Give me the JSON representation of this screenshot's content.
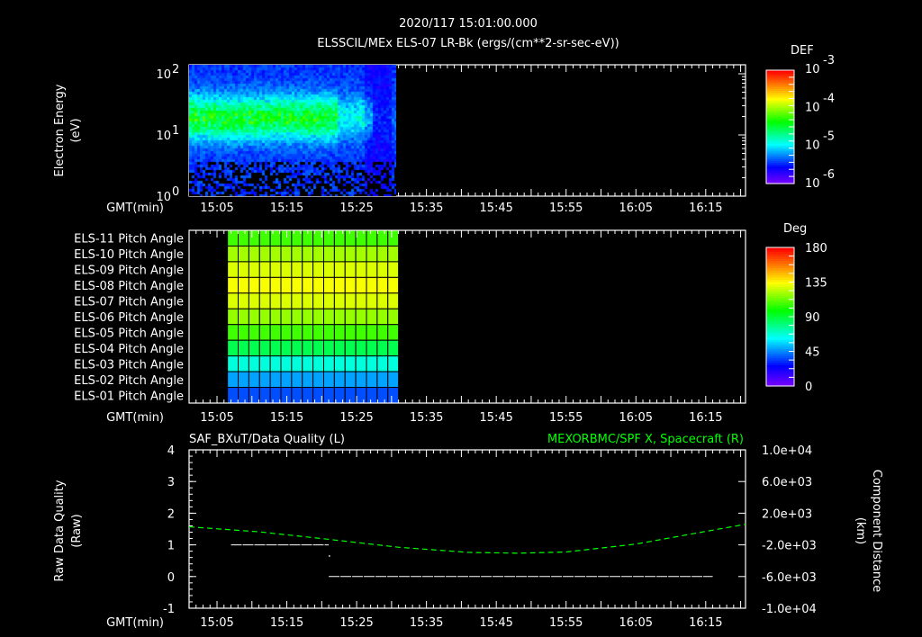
{
  "header": {
    "timestamp": "2020/117 15:01:00.000",
    "title": "ELSSCIL/MEx ELS-07 LR-Bk  (ergs/(cm**2-sr-sec-eV))"
  },
  "time_axis": {
    "label": "GMT(min)",
    "start_min": 901,
    "end_min": 980.7,
    "ticks": [
      "15:05",
      "15:15",
      "15:25",
      "15:35",
      "15:45",
      "15:55",
      "16:05",
      "16:15"
    ],
    "tick_minutes": [
      905,
      915,
      925,
      935,
      945,
      955,
      965,
      975
    ]
  },
  "chart_data": [
    {
      "type": "heatmap",
      "title": "ELSSCIL/MEx ELS-07 LR-Bk  (ergs/(cm**2-sr-sec-eV))",
      "ylabel": "Electron Energy\n(eV)",
      "ylabel_lines": [
        "Electron Energy",
        "(eV)"
      ],
      "yscale": "log",
      "ylim": [
        1,
        140
      ],
      "yticks": [
        {
          "value": 1,
          "label": "10",
          "exp": "0"
        },
        {
          "value": 10,
          "label": "10",
          "exp": "1"
        },
        {
          "value": 100,
          "label": "10",
          "exp": "2"
        }
      ],
      "data_time_range": [
        "15:01",
        "15:31"
      ],
      "colorbar": {
        "title": "DEF",
        "scale": "log",
        "range": [
          1e-06,
          0.001
        ],
        "ticks": [
          {
            "label": "10",
            "exp": "-3"
          },
          {
            "label": "10",
            "exp": "-4"
          },
          {
            "label": "10",
            "exp": "-5"
          },
          {
            "label": "10",
            "exp": "-6"
          }
        ]
      }
    },
    {
      "type": "heatmap",
      "rows": [
        "ELS-11 Pitch Angle",
        "ELS-10 Pitch Angle",
        "ELS-09 Pitch Angle",
        "ELS-08 Pitch Angle",
        "ELS-07 Pitch Angle",
        "ELS-06 Pitch Angle",
        "ELS-05 Pitch Angle",
        "ELS-04 Pitch Angle",
        "ELS-03 Pitch Angle",
        "ELS-02 Pitch Angle",
        "ELS-01 Pitch Angle"
      ],
      "row_values_deg": [
        108,
        122,
        130,
        134,
        130,
        120,
        108,
        88,
        68,
        50,
        38
      ],
      "data_time_range": [
        "15:06.5",
        "15:31"
      ],
      "columns": 16,
      "colorbar": {
        "title": "Deg",
        "range": [
          0,
          180
        ],
        "ticks": [
          "180",
          "135",
          "90",
          "45",
          "0"
        ]
      }
    },
    {
      "type": "line",
      "title_left": "SAF_BXuT/Data Quality (L)",
      "title_right": "MEXORBMC/SPF X, Spacecraft (R)",
      "ylabel_left": [
        "Raw Data Quality",
        "(Raw)"
      ],
      "ylabel_right": [
        "Component Distance",
        "(km)"
      ],
      "ylim_left": [
        -1,
        4
      ],
      "yticks_left": [
        "4",
        "3",
        "2",
        "1",
        "0",
        "-1"
      ],
      "ylim_right": [
        -10000,
        10000
      ],
      "yticks_right": [
        "1.0e+04",
        "6.0e+03",
        "2.0e+03",
        "-2.0e+03",
        "-6.0e+03",
        "-1.0e+04"
      ],
      "series": [
        {
          "name": "Data Quality",
          "axis": "left",
          "color": "#ffffff",
          "segments": [
            {
              "t": [
                907,
                921
              ],
              "y": [
                1,
                1
              ]
            },
            {
              "t": [
                921,
                921
              ],
              "y": [
                0.67,
                0.67
              ]
            },
            {
              "t": [
                921,
                976
              ],
              "y": [
                0,
                0
              ]
            }
          ]
        },
        {
          "name": "SPF X, Spacecraft",
          "axis": "right",
          "color": "#00ff00",
          "t": [
            901,
            911,
            921,
            931,
            941,
            948,
            955,
            965,
            975,
            980.7
          ],
          "y": [
            280,
            -350,
            -1300,
            -2300,
            -2950,
            -3050,
            -2900,
            -1900,
            -300,
            600
          ]
        }
      ]
    }
  ],
  "colors": {
    "background": "#000000",
    "axes": "#ffffff",
    "green_series": "#00ff00"
  }
}
